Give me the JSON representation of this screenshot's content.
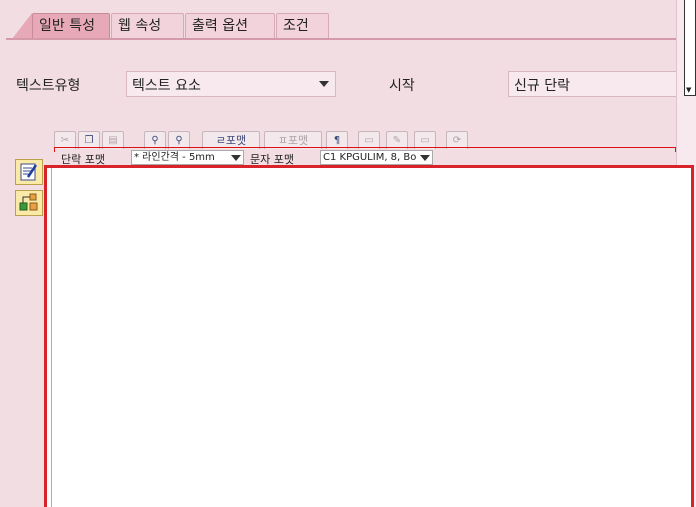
{
  "tabs": [
    {
      "label": "일반 특성",
      "active": true
    },
    {
      "label": "웹 속성",
      "active": false
    },
    {
      "label": "출력 옵션",
      "active": false
    },
    {
      "label": "조건",
      "active": false
    }
  ],
  "form": {
    "text_type_label": "텍스트유형",
    "text_type_value": "텍스트 요소",
    "start_label": "시작",
    "start_value": "신규 단락"
  },
  "toolbar": {
    "paragraph_format_btn": "ㄹ포맷",
    "char_format_btn": "ㅍ포맷",
    "paragraph_format_label": "단락 포맷",
    "paragraph_format_value": "* 라인간격 - 5mm",
    "char_format_label": "문자 포맷",
    "char_format_value": "C1 KPGULIM, 8, Bo"
  },
  "colors": {
    "background": "#f2dde3",
    "active_tab": "#e7a9b8",
    "editor_border": "#d9232b"
  }
}
